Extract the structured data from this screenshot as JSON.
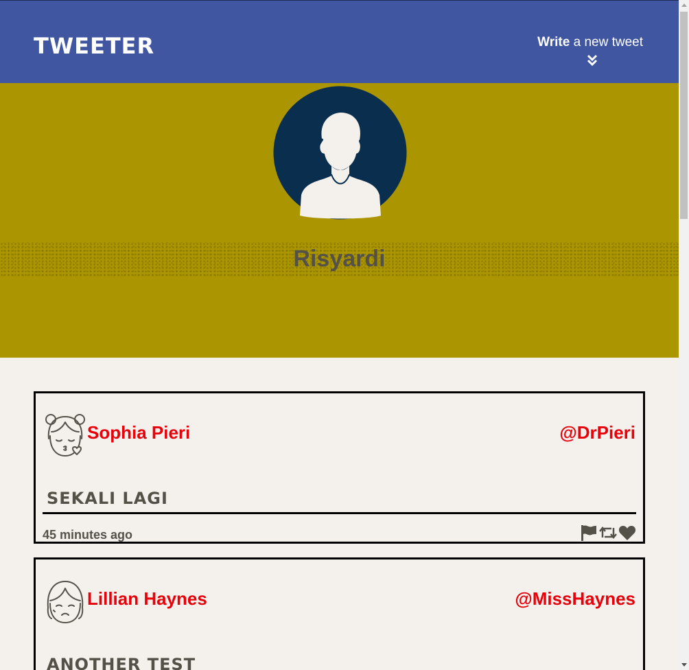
{
  "nav": {
    "brand": "Tweeter",
    "compose_strong": "Write",
    "compose_light": " a new tweet",
    "compose_icon": "double-chevron-down-icon"
  },
  "profile": {
    "name": "Risyardi",
    "avatar_icon": "default-user-avatar-icon",
    "background_color": "#ab9500",
    "avatar_color": "#0a2e4e"
  },
  "theme": {
    "nav_color": "#4056a1",
    "accent_red": "#e8000b",
    "text_gray": "#545149",
    "page_bg": "#f4f1ec"
  },
  "tweets": [
    {
      "avatar_icon": "girl-kissing-face-icon",
      "name": "Sophia Pieri",
      "handle": "@DrPieri",
      "text": "sekali lagi",
      "time": "45 minutes ago",
      "actions": [
        "flag-icon",
        "retweet-icon",
        "heart-icon"
      ]
    },
    {
      "avatar_icon": "girl-sad-face-icon",
      "name": "Lillian Haynes",
      "handle": "@MissHaynes",
      "text": "another test"
    }
  ]
}
